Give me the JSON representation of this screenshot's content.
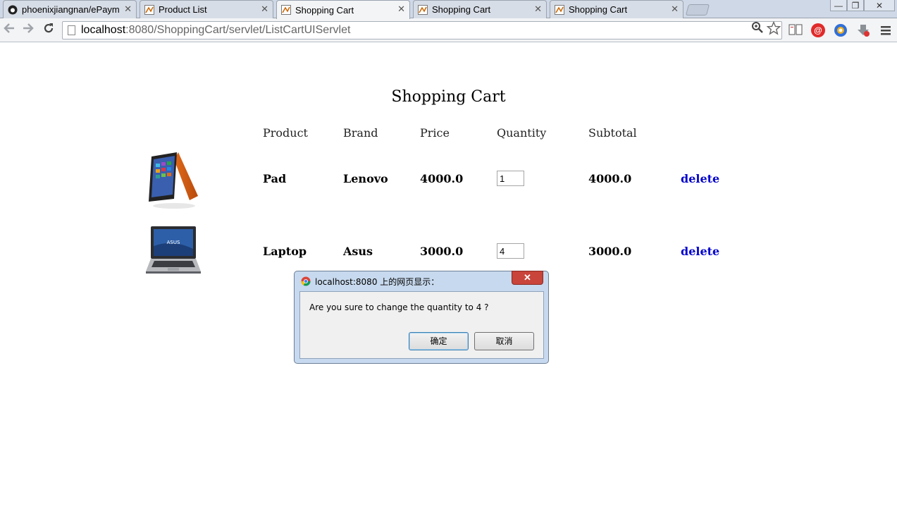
{
  "browser": {
    "tabs": [
      {
        "title": "phoenixjiangnan/ePaym",
        "icon": "github-icon",
        "active": false
      },
      {
        "title": "Product List",
        "icon": "page-favicon-icon",
        "active": false
      },
      {
        "title": "Shopping Cart",
        "icon": "page-favicon-icon",
        "active": true
      },
      {
        "title": "Shopping Cart",
        "icon": "page-favicon-icon",
        "active": false
      },
      {
        "title": "Shopping Cart",
        "icon": "page-favicon-icon",
        "active": false
      }
    ],
    "tab_close_glyph": "✕",
    "window_controls": {
      "minimize": "—",
      "restore": "❐",
      "close": "✕"
    },
    "url_host": "localhost",
    "url_rest": ":8080/ShoppingCart/servlet/ListCartUIServlet"
  },
  "cart": {
    "title": "Shopping Cart",
    "headers": {
      "product": "Product",
      "brand": "Brand",
      "price": "Price",
      "quantity": "Quantity",
      "subtotal": "Subtotal"
    },
    "rows": [
      {
        "image": "lenovo-yoga-laptop-image",
        "product": "Pad",
        "brand": "Lenovo",
        "price": "4000.0",
        "quantity": "1",
        "subtotal": "4000.0",
        "action": "delete"
      },
      {
        "image": "asus-laptop-image",
        "product": "Laptop",
        "brand": "Asus",
        "price": "3000.0",
        "quantity": "4",
        "subtotal": "3000.0",
        "action": "delete"
      }
    ]
  },
  "dialog": {
    "title": "localhost:8080 上的网页显示：",
    "message": "Are you sure to change the quantity to 4 ?",
    "ok_label": "确定",
    "cancel_label": "取消",
    "close_glyph": "✕"
  },
  "colors": {
    "link": "#0000cc",
    "dialog_frame": "#c7d9ee",
    "close_button": "#c9443a"
  }
}
